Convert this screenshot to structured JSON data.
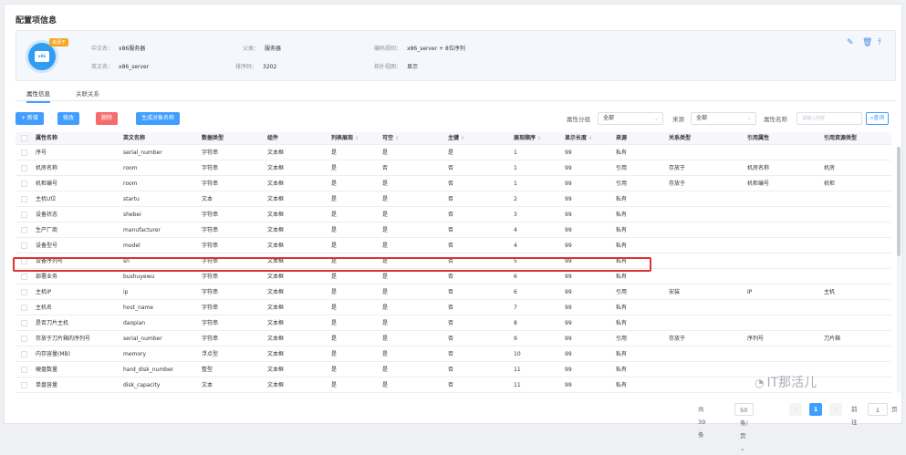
{
  "page": {
    "title": "配置项信息"
  },
  "info": {
    "badge": "来源于",
    "logo_text": "x86",
    "fields": [
      {
        "k": "中文名：",
        "v": "x86服务器"
      },
      {
        "k": "英文名：",
        "v": "x86_server"
      },
      {
        "k": "父类：",
        "v": "服务器"
      },
      {
        "k": "排序码：",
        "v": "3202"
      },
      {
        "k": "编码规则：",
        "v": "x86_server + 8位序列"
      },
      {
        "k": "拓扑视图：",
        "v": "显示"
      }
    ],
    "icons": [
      "edit-icon",
      "delete-icon",
      "upload-icon"
    ]
  },
  "tabs": [
    {
      "label": "属性信息",
      "active": true
    },
    {
      "label": "关联关系",
      "active": false
    }
  ],
  "toolbar": {
    "add": "+ 新增",
    "edit": "修改",
    "delete": "删除",
    "generate": "生成对象名称",
    "group_label": "属性分组",
    "group_value": "全部",
    "source_label": "来源",
    "source_value": "全部",
    "name_label": "属性名称",
    "name_placeholder": "请输入内容",
    "search": "查询"
  },
  "table": {
    "headers": [
      "属性名称",
      "英文名称",
      "数据类型",
      "组件",
      "列表展现",
      "可空",
      "主键",
      "展现顺序",
      "显示长度",
      "来源",
      "关系类型",
      "引用属性",
      "引用资源类型"
    ],
    "rows": [
      [
        "序号",
        "serial_number",
        "字符串",
        "文本框",
        "是",
        "是",
        "是",
        "1",
        "99",
        "私有",
        "",
        "",
        ""
      ],
      [
        "机房名称",
        "room",
        "字符串",
        "文本框",
        "是",
        "否",
        "否",
        "1",
        "99",
        "引用",
        "存放于",
        "机房名称",
        "机房"
      ],
      [
        "机柜编号",
        "room",
        "字符串",
        "文本框",
        "是",
        "是",
        "否",
        "1",
        "99",
        "引用",
        "存放于",
        "机柜编号",
        "机柜"
      ],
      [
        "主机U位",
        "startu",
        "文本",
        "文本框",
        "是",
        "是",
        "否",
        "2",
        "99",
        "私有",
        "",
        "",
        ""
      ],
      [
        "设备状态",
        "shebei",
        "字符串",
        "文本框",
        "是",
        "是",
        "否",
        "3",
        "99",
        "私有",
        "",
        "",
        ""
      ],
      [
        "生产厂商",
        "manufacturer",
        "字符串",
        "文本框",
        "是",
        "是",
        "否",
        "4",
        "99",
        "私有",
        "",
        "",
        ""
      ],
      [
        "设备型号",
        "model",
        "字符串",
        "文本框",
        "是",
        "是",
        "否",
        "4",
        "99",
        "私有",
        "",
        "",
        ""
      ],
      [
        "设备序列号",
        "sn",
        "字符串",
        "文本框",
        "是",
        "是",
        "否",
        "5",
        "99",
        "私有",
        "",
        "",
        ""
      ],
      [
        "部署业务",
        "bushuyewu",
        "字符串",
        "文本框",
        "是",
        "是",
        "否",
        "6",
        "99",
        "私有",
        "",
        "",
        ""
      ],
      [
        "主机IP",
        "ip",
        "字符串",
        "文本框",
        "是",
        "是",
        "否",
        "6",
        "99",
        "引用",
        "安装",
        "IP",
        "主机"
      ],
      [
        "主机名",
        "host_name",
        "字符串",
        "文本框",
        "是",
        "是",
        "否",
        "7",
        "99",
        "私有",
        "",
        "",
        ""
      ],
      [
        "是否刀片主机",
        "daopian",
        "字符串",
        "文本框",
        "是",
        "是",
        "否",
        "8",
        "99",
        "私有",
        "",
        "",
        ""
      ],
      [
        "存放于刀片箱的序列号",
        "serial_number",
        "字符串",
        "文本框",
        "是",
        "是",
        "否",
        "9",
        "99",
        "引用",
        "存放于",
        "序列号",
        "刀片箱"
      ],
      [
        "内存容量(MB)",
        "memory",
        "浮点型",
        "文本框",
        "是",
        "是",
        "否",
        "10",
        "99",
        "私有",
        "",
        "",
        ""
      ],
      [
        "硬盘数量",
        "hard_disk_number",
        "整型",
        "文本框",
        "是",
        "是",
        "否",
        "11",
        "99",
        "私有",
        "",
        "",
        ""
      ],
      [
        "单盘容量",
        "disk_capacity",
        "文本",
        "文本框",
        "是",
        "是",
        "否",
        "11",
        "99",
        "私有",
        "",
        "",
        ""
      ]
    ]
  },
  "pager": {
    "total": "共 39 条",
    "page_size": "50条/页",
    "prev": "‹",
    "current": "1",
    "next": "›",
    "goto_label": "前往",
    "goto_value": "1",
    "page_suffix": "页"
  },
  "watermark": {
    "text": "IT那活儿"
  }
}
